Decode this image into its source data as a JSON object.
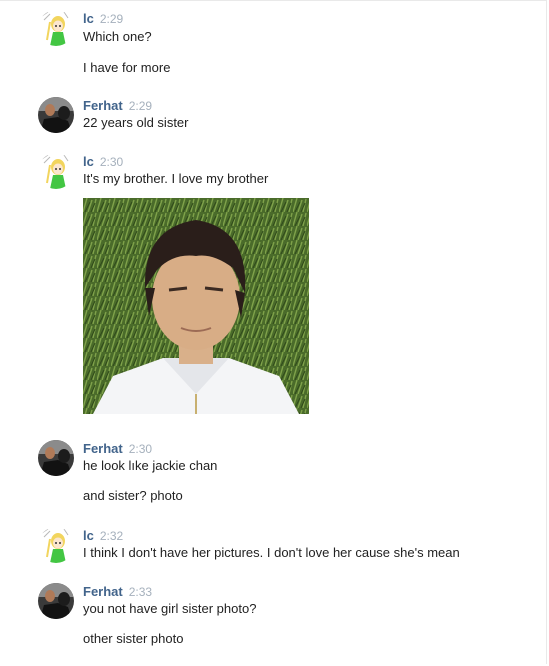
{
  "messages": [
    {
      "author": "lc",
      "time": "2:29",
      "lines": [
        "Which one?",
        "I have for more"
      ]
    },
    {
      "author": "Ferhat",
      "time": "2:29",
      "lines": [
        "22 years old sister"
      ]
    },
    {
      "author": "lc",
      "time": "2:30",
      "lines": [
        "It's my brother. I love my brother"
      ]
    },
    {
      "author": "Ferhat",
      "time": "2:30",
      "lines": [
        "he look lıke jackie chan",
        "and sister? photo"
      ]
    },
    {
      "author": "lc",
      "time": "2:32",
      "lines": [
        "I think I don't have her pictures. I don't love her cause she's mean"
      ]
    },
    {
      "author": "Ferhat",
      "time": "2:33",
      "lines": [
        "you not have girl sister photo?",
        "other sister photo"
      ]
    }
  ],
  "colors": {
    "author": "#42648b",
    "time": "#a5b0bc",
    "text": "#222222"
  },
  "icons": {
    "lc_avatar": "anime-girl-avatar-icon",
    "ferhat_avatar": "man-avatar-icon"
  }
}
